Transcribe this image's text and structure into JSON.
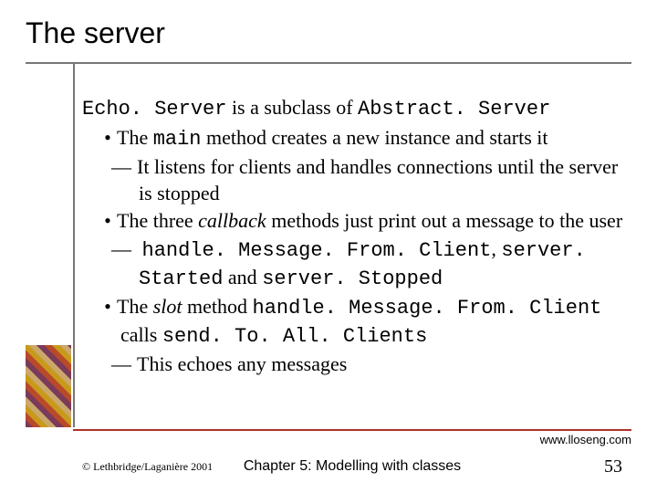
{
  "title": "The server",
  "intro": {
    "code1": "Echo. Server",
    "text1": " is a subclass of ",
    "code2": "Abstract. Server"
  },
  "b1_1": {
    "pre": "The ",
    "code": "main",
    "post": " method creates a new instance and starts it"
  },
  "b2_1": "It listens for clients and handles connections until the server is stopped",
  "b1_2": {
    "pre": "The three ",
    "ital": "callback",
    "post": " methods just print out a message to the user"
  },
  "b2_2": {
    "code1": "handle. Message. From. Client",
    "sep1": ", ",
    "code2": "server. Started",
    "sep2": " and ",
    "code3": "server. Stopped"
  },
  "b1_3": {
    "pre": "The ",
    "ital": "slot",
    "mid": " method ",
    "code1": "handle. Message. From. Client",
    "mid2": " calls ",
    "code2": "send. To. All. Clients"
  },
  "b2_3": "This echoes any messages",
  "url": "www.lloseng.com",
  "copyright": "© Lethbridge/Laganière 2001",
  "chapter": "Chapter 5: Modelling with classes",
  "page": "53",
  "bullets": {
    "dot": "•",
    "dash": "—"
  }
}
